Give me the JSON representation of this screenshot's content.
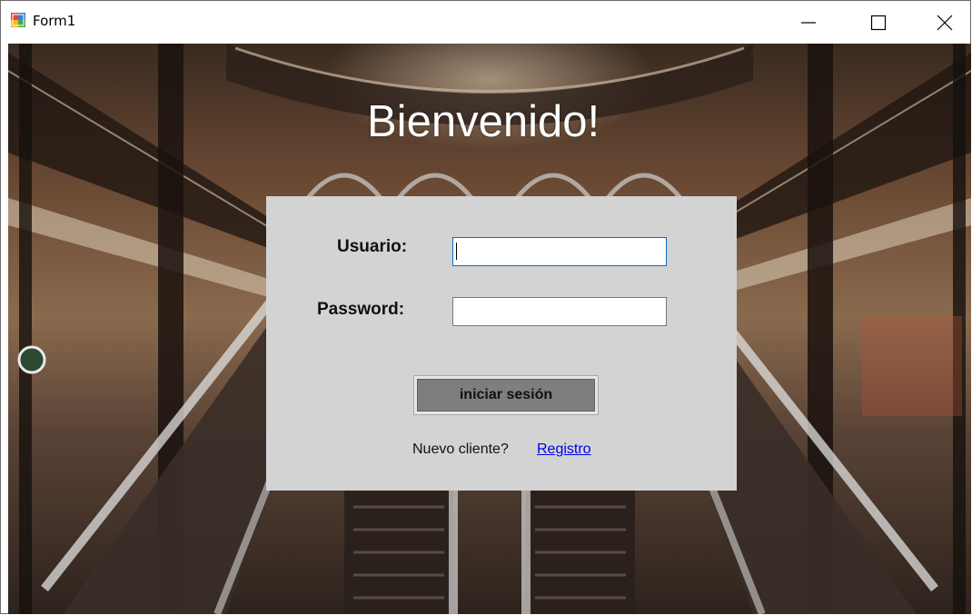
{
  "window": {
    "title": "Form1",
    "icon": "winforms-app-icon",
    "controls": [
      "minimize-icon",
      "maximize-icon",
      "close-icon"
    ]
  },
  "background": {
    "description_icon": "mall-escalator-photo"
  },
  "login": {
    "welcome": "Bienvenido!",
    "user_label": "Usuario:",
    "user_value": "",
    "password_label": "Password:",
    "password_value": "",
    "submit_label": "iniciar sesión",
    "new_client_text": "Nuevo cliente?",
    "register_link": "Registro"
  },
  "colors": {
    "panel": "#d3d3d3",
    "button": "#7e7e7e",
    "focus_border": "#0a6ac7",
    "link": "#0000ee"
  }
}
